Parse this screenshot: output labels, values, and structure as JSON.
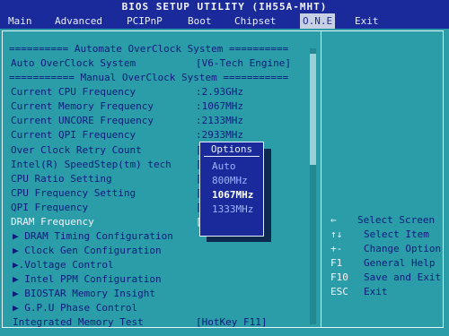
{
  "title": "BIOS SETUP UTILITY (IH55A-MHT)",
  "menu": [
    "Main",
    "Advanced",
    "PCIPnP",
    "Boot",
    "Chipset",
    "O.N.E",
    "Exit"
  ],
  "active_menu": "O.N.E",
  "sections": {
    "automate_header": "========== Automate OverClock System ==========",
    "manual_header": "=========== Manual OverClock System ==========="
  },
  "auto_overclock": {
    "label": "Auto OverClock System",
    "value": "[V6-Tech Engine]"
  },
  "readouts": [
    {
      "label": "Current CPU Frequency",
      "value": ":2.93GHz"
    },
    {
      "label": "Current Memory Frequency",
      "value": ":1067MHz"
    },
    {
      "label": "Current UNCORE Frequency",
      "value": ":2133MHz"
    },
    {
      "label": "Current QPI Frequency",
      "value": ":2933MHz"
    }
  ],
  "settings": [
    {
      "label": "Over Clock Retry Count",
      "value": "["
    },
    {
      "label": "Intel(R) SpeedStep(tm) tech",
      "value": "["
    },
    {
      "label": "CPU Ratio Setting",
      "value": "["
    },
    {
      "label": "CPU Frequency Setting",
      "value": "["
    },
    {
      "label": "QPI Frequency",
      "value": "["
    },
    {
      "label": "DRAM Frequency",
      "value": "["
    }
  ],
  "submenus": [
    "▶ DRAM Timing Configuration",
    "▶ Clock Gen Configuration",
    "▶.Voltage Control",
    "▶ Intel PPM Configuration",
    "▶ BIOSTAR Memory Insight",
    "▶ G.P.U Phase Control"
  ],
  "integrated_memory_test": {
    "label": "Integrated Memory Test",
    "value": "[HotKey F11]"
  },
  "popup": {
    "title": "Options",
    "options": [
      "Auto",
      "800MHz",
      "1067MHz",
      "1333MHz"
    ],
    "selected": "1067MHz"
  },
  "help": [
    {
      "key": "←",
      "desc": "Select Screen"
    },
    {
      "key": "↑↓",
      "desc": "Select Item"
    },
    {
      "key": "+-",
      "desc": "Change Option"
    },
    {
      "key": "F1",
      "desc": "General Help"
    },
    {
      "key": "F10",
      "desc": "Save and Exit"
    },
    {
      "key": "ESC",
      "desc": "Exit"
    }
  ],
  "colors": {
    "background": "#2b9da9",
    "bar": "#1a2a9a",
    "text": "#0c1c7c",
    "highlight": "#f2f6ff"
  }
}
